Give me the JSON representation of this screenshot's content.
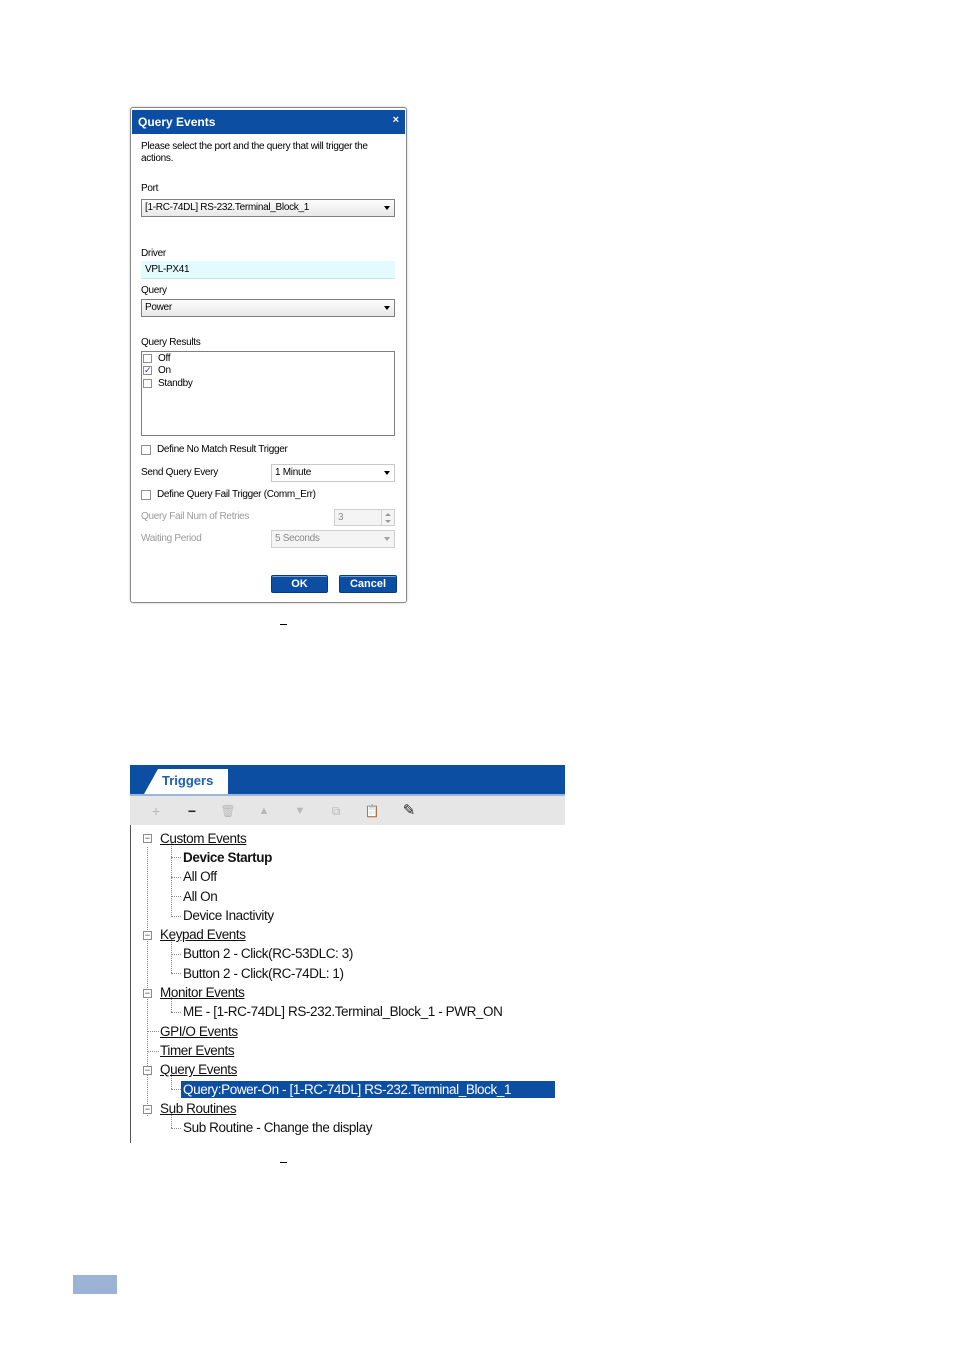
{
  "query_dialog": {
    "title": "Query Events",
    "close_glyph": "×",
    "instructions": "Please select the port and the query that will trigger the actions.",
    "port_label": "Port",
    "port_value": "[1-RC-74DL] RS-232.Terminal_Block_1",
    "driver_label": "Driver",
    "driver_value": "VPL-PX41",
    "query_label": "Query",
    "query_value": "Power",
    "results_label": "Query Results",
    "results": [
      {
        "label": "Off",
        "checked": false
      },
      {
        "label": "On",
        "checked": true
      },
      {
        "label": "Standby",
        "checked": false
      }
    ],
    "no_match_label": "Define No Match Result Trigger",
    "send_every_label": "Send Query Every",
    "send_every_value": "1 Minute",
    "fail_trigger_label": "Define Query Fail Trigger (Comm_Err)",
    "retries_label": "Query Fail Num of Retries",
    "retries_value": "3",
    "waiting_label": "Waiting Period",
    "waiting_value": "5 Seconds",
    "ok_label": "OK",
    "cancel_label": "Cancel",
    "check_glyph": "✓"
  },
  "triggers": {
    "tab_label": "Triggers",
    "toolbar": {
      "add": "+",
      "remove": "−",
      "delete": "🗑",
      "up": "▲",
      "down": "▼",
      "copy": "⧉",
      "paste": "📋",
      "edit": "✎"
    },
    "expander_glyph": "−",
    "tree": {
      "custom_events": "Custom Events",
      "device_startup": "Device Startup",
      "all_off": "All Off",
      "all_on": "All On",
      "device_inactivity": "Device Inactivity",
      "keypad_events": "Keypad Events",
      "keypad_1": "Button 2 - Click(RC-53DLC: 3)",
      "keypad_2": "Button 2 - Click(RC-74DL: 1)",
      "monitor_events": "Monitor Events",
      "monitor_1": "ME - [1-RC-74DL] RS-232.Terminal_Block_1 - PWR_ON",
      "gpio_events": "GPI/O Events",
      "timer_events": "Timer Events",
      "query_events": "Query Events",
      "query_1": "Query:Power-On - [1-RC-74DL] RS-232.Terminal_Block_1",
      "sub_routines": "Sub Routines",
      "sub_1": "Sub Routine - Change the display"
    }
  },
  "colors": {
    "accent": "#0b4ea2",
    "driver_bg": "#e3fbfd",
    "footer_bar": "#9db3d6"
  }
}
